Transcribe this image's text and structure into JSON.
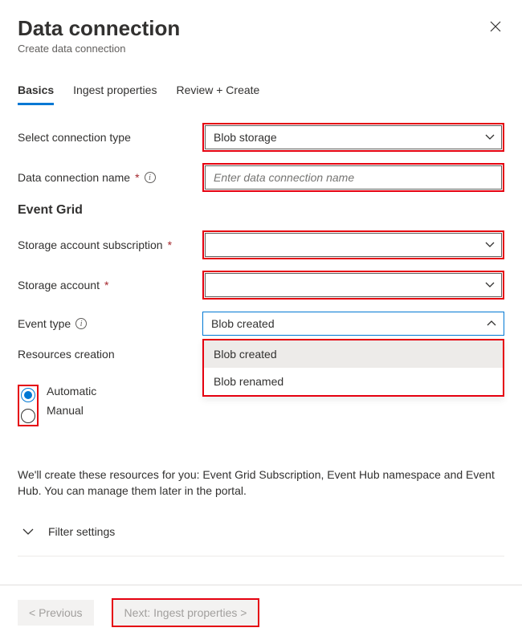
{
  "header": {
    "title": "Data connection",
    "subtitle": "Create data connection"
  },
  "tabs": {
    "basics": "Basics",
    "ingest": "Ingest properties",
    "review": "Review + Create"
  },
  "form": {
    "connection_type_label": "Select connection type",
    "connection_type_value": "Blob storage",
    "data_connection_name_label": "Data connection name",
    "data_connection_name_placeholder": "Enter data connection name",
    "event_grid_heading": "Event Grid",
    "storage_subscription_label": "Storage account subscription",
    "storage_subscription_value": "",
    "storage_account_label": "Storage account",
    "storage_account_value": "",
    "event_type_label": "Event type",
    "event_type_value": "Blob created",
    "event_type_options": {
      "opt0": "Blob created",
      "opt1": "Blob renamed"
    },
    "resources_creation_label": "Resources creation",
    "resources_creation_options": {
      "automatic": "Automatic",
      "manual": "Manual"
    },
    "resources_creation_selected": "automatic",
    "help_text": "We'll create these resources for you: Event Grid Subscription, Event Hub namespace and Event Hub. You can manage them later in the portal.",
    "filter_settings_label": "Filter settings"
  },
  "footer": {
    "previous": "< Previous",
    "next": "Next: Ingest properties >"
  }
}
